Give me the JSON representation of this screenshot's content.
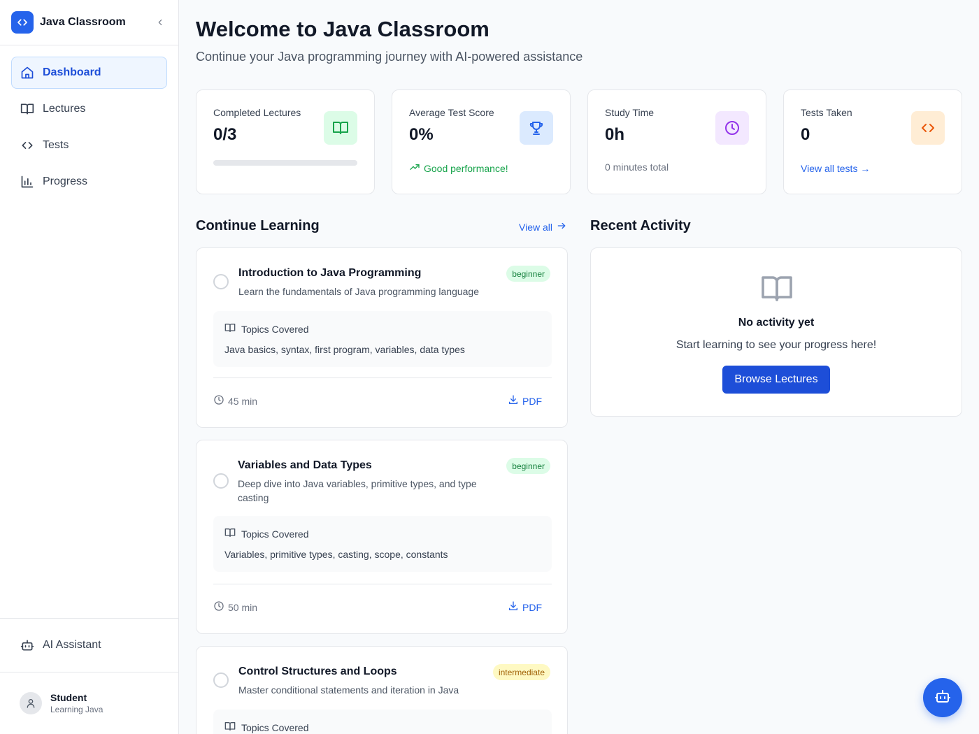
{
  "app": {
    "name": "Java Classroom"
  },
  "sidebar": {
    "items": [
      {
        "label": "Dashboard",
        "icon": "home-icon",
        "active": true
      },
      {
        "label": "Lectures",
        "icon": "book-icon",
        "active": false
      },
      {
        "label": "Tests",
        "icon": "code-icon",
        "active": false
      },
      {
        "label": "Progress",
        "icon": "bar-chart-icon",
        "active": false
      }
    ],
    "ai_assistant": {
      "label": "AI Assistant",
      "icon": "bot-icon"
    },
    "user": {
      "name": "Student",
      "subtitle": "Learning Java"
    }
  },
  "header": {
    "title": "Welcome to Java Classroom",
    "subtitle": "Continue your Java programming journey with AI-powered assistance"
  },
  "stats": [
    {
      "label": "Completed Lectures",
      "value": "0/3",
      "progress": 0,
      "icon": "book-open-icon",
      "color": "#16a34a",
      "bg": "#dcfce7"
    },
    {
      "label": "Average Test Score",
      "value": "0%",
      "footer": "Good performance!",
      "footer_icon": "trending-up-icon",
      "icon": "trophy-icon",
      "color": "#2563eb",
      "bg": "#dbeafe"
    },
    {
      "label": "Study Time",
      "value": "0h",
      "footer": "0 minutes total",
      "icon": "clock-icon",
      "color": "#9333ea",
      "bg": "#f3e8ff"
    },
    {
      "label": "Tests Taken",
      "value": "0",
      "footer": "View all tests →",
      "icon": "code-icon",
      "color": "#ea580c",
      "bg": "#ffedd5"
    }
  ],
  "continue_learning": {
    "title": "Continue Learning",
    "view_all": "View all",
    "topics_label": "Topics Covered",
    "pdf_label": "PDF",
    "lectures": [
      {
        "title": "Introduction to Java Programming",
        "description": "Learn the fundamentals of Java programming language",
        "level": "beginner",
        "topics": "Java basics, syntax, first program, variables, data types",
        "duration": "45 min"
      },
      {
        "title": "Variables and Data Types",
        "description": "Deep dive into Java variables, primitive types, and type casting",
        "level": "beginner",
        "topics": "Variables, primitive types, casting, scope, constants",
        "duration": "50 min"
      },
      {
        "title": "Control Structures and Loops",
        "description": "Master conditional statements and iteration in Java",
        "level": "intermediate",
        "topics": "",
        "duration": ""
      }
    ]
  },
  "recent_activity": {
    "title": "Recent Activity",
    "empty_title": "No activity yet",
    "empty_subtitle": "Start learning to see your progress here!",
    "button": "Browse Lectures"
  },
  "fab": {
    "icon": "bot-icon"
  }
}
